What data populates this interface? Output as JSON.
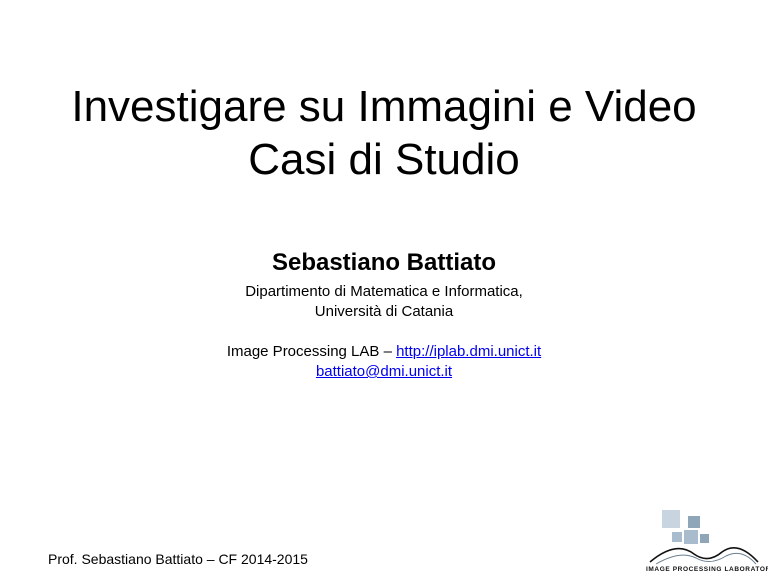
{
  "slide": {
    "title_line1": "Investigare su Immagini e Video",
    "title_line2": "Casi di Studio",
    "author": "Sebastiano Battiato",
    "affiliation_line1": "Dipartimento di Matematica e Informatica,",
    "affiliation_line2": "Università di Catania",
    "lab_prefix": "Image Processing LAB – ",
    "lab_url": "http://iplab.dmi.unict.it",
    "email": "battiato@dmi.unict.it",
    "footer": "Prof. Sebastiano Battiato – CF 2014-2015",
    "logo_text": "IMAGE PROCESSING LABORATORY"
  },
  "colors": {
    "link": "#0000ee",
    "logo_square_light": "#c8d4e0",
    "logo_square_mid": "#a9bccd",
    "logo_square_dark": "#8fa5b8"
  }
}
